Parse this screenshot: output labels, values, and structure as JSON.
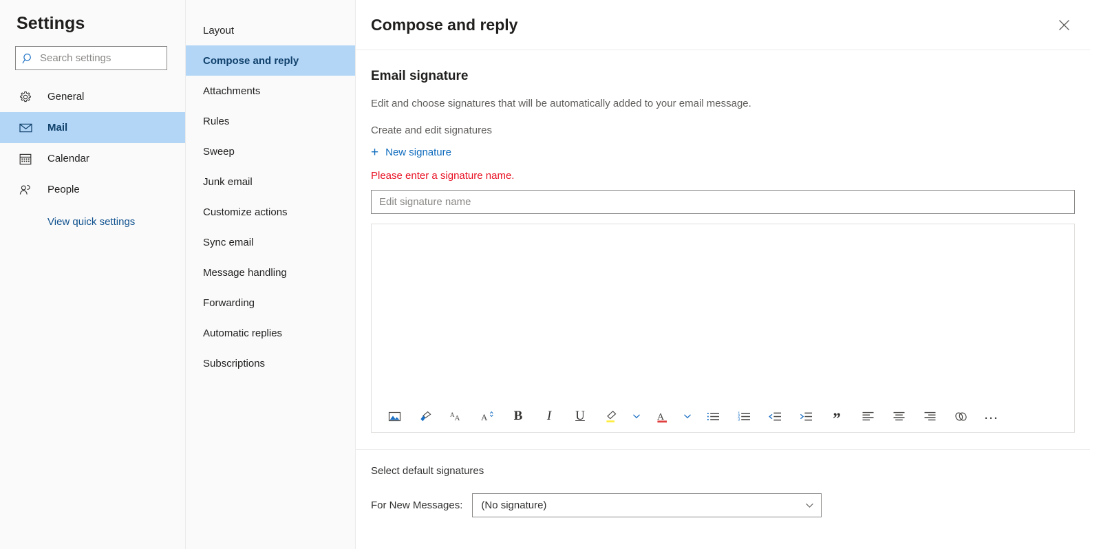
{
  "rail": {
    "title": "Settings",
    "search": {
      "placeholder": "Search settings",
      "value": "",
      "icon": "search-icon"
    },
    "items": [
      {
        "label": "General",
        "icon": "gear-icon",
        "selected": false
      },
      {
        "label": "Mail",
        "icon": "envelope-icon",
        "selected": true
      },
      {
        "label": "Calendar",
        "icon": "calendar-icon",
        "selected": false
      },
      {
        "label": "People",
        "icon": "people-icon",
        "selected": false
      }
    ],
    "quick_settings_link": "View quick settings"
  },
  "subnav": {
    "items": [
      {
        "label": "Layout",
        "selected": false
      },
      {
        "label": "Compose and reply",
        "selected": true
      },
      {
        "label": "Attachments",
        "selected": false
      },
      {
        "label": "Rules",
        "selected": false
      },
      {
        "label": "Sweep",
        "selected": false
      },
      {
        "label": "Junk email",
        "selected": false
      },
      {
        "label": "Customize actions",
        "selected": false
      },
      {
        "label": "Sync email",
        "selected": false
      },
      {
        "label": "Message handling",
        "selected": false
      },
      {
        "label": "Forwarding",
        "selected": false
      },
      {
        "label": "Automatic replies",
        "selected": false
      },
      {
        "label": "Subscriptions",
        "selected": false
      }
    ]
  },
  "header": {
    "title": "Compose and reply",
    "close_icon": "close-icon"
  },
  "signature": {
    "section_title": "Email signature",
    "description": "Edit and choose signatures that will be automatically added to your email message.",
    "create_label": "Create and edit signatures",
    "new_signature_label": "New signature",
    "new_signature_plus": "+",
    "error_message": "Please enter a signature name.",
    "name_input": {
      "placeholder": "Edit signature name",
      "value": ""
    },
    "body_value": ""
  },
  "toolbar": {
    "items": [
      {
        "name": "insert-picture-icon",
        "type": "icon",
        "label": "Insert picture"
      },
      {
        "name": "format-painter-icon",
        "type": "icon",
        "label": "Format painter"
      },
      {
        "name": "font-size-icon",
        "type": "icon",
        "label": "Font size"
      },
      {
        "name": "grow-font-icon",
        "type": "icon",
        "label": "Grow font"
      },
      {
        "name": "bold-button",
        "type": "text",
        "label": "B"
      },
      {
        "name": "italic-button",
        "type": "text",
        "label": "I"
      },
      {
        "name": "underline-button",
        "type": "text",
        "label": "U"
      },
      {
        "name": "highlight-icon",
        "type": "icon",
        "label": "Text highlight color"
      },
      {
        "name": "highlight-caret-icon",
        "type": "caret",
        "label": "Highlight options"
      },
      {
        "name": "font-color-icon",
        "type": "icon",
        "label": "Font color"
      },
      {
        "name": "font-color-caret-icon",
        "type": "caret",
        "label": "Font color options"
      },
      {
        "name": "bulleted-list-icon",
        "type": "icon",
        "label": "Bulleted list"
      },
      {
        "name": "numbered-list-icon",
        "type": "icon",
        "label": "Numbered list"
      },
      {
        "name": "decrease-indent-icon",
        "type": "icon",
        "label": "Decrease indent"
      },
      {
        "name": "increase-indent-icon",
        "type": "icon",
        "label": "Increase indent"
      },
      {
        "name": "quote-button",
        "type": "text",
        "label": "”"
      },
      {
        "name": "align-left-icon",
        "type": "icon",
        "label": "Align left"
      },
      {
        "name": "align-center-icon",
        "type": "icon",
        "label": "Align center"
      },
      {
        "name": "align-right-icon",
        "type": "icon",
        "label": "Align right"
      },
      {
        "name": "insert-link-icon",
        "type": "icon",
        "label": "Insert link"
      },
      {
        "name": "more-options-button",
        "type": "text",
        "label": "…"
      }
    ]
  },
  "defaults": {
    "title": "Select default signatures",
    "new_messages_label": "For New Messages:",
    "new_messages_value": "(No signature)"
  },
  "colors": {
    "accent": "#0f6cbd",
    "selected_bg": "#b3d6f7",
    "selected_text": "#10416b",
    "error": "#e81123",
    "rail_bg": "#fafafa",
    "highlight_yellow": "#ffeb3b",
    "font_color_red": "#e03e3e"
  }
}
